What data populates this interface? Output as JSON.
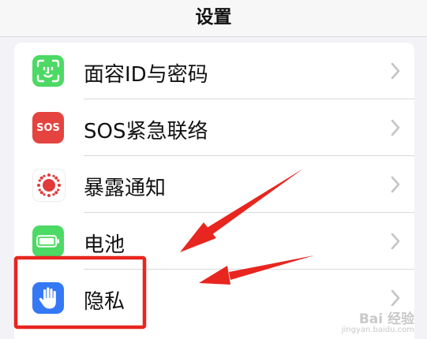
{
  "header": {
    "title": "设置"
  },
  "settings_rows": [
    {
      "label": "面容ID与密码",
      "icon": "face-id-icon",
      "icon_color": "#4cd964"
    },
    {
      "label": "SOS紧急联络",
      "icon": "sos-icon",
      "icon_text": "SOS",
      "icon_color": "#e5433f"
    },
    {
      "label": "暴露通知",
      "icon": "exposure-notification-icon",
      "icon_color": "#e03a3a"
    },
    {
      "label": "电池",
      "icon": "battery-icon",
      "icon_color": "#4cd964"
    },
    {
      "label": "隐私",
      "icon": "hand-icon",
      "icon_color": "#3478f6"
    }
  ],
  "annotation_color": "#e8251f",
  "watermark": {
    "text": "Bai 经验",
    "sub": "jingyan.baidu.com"
  }
}
